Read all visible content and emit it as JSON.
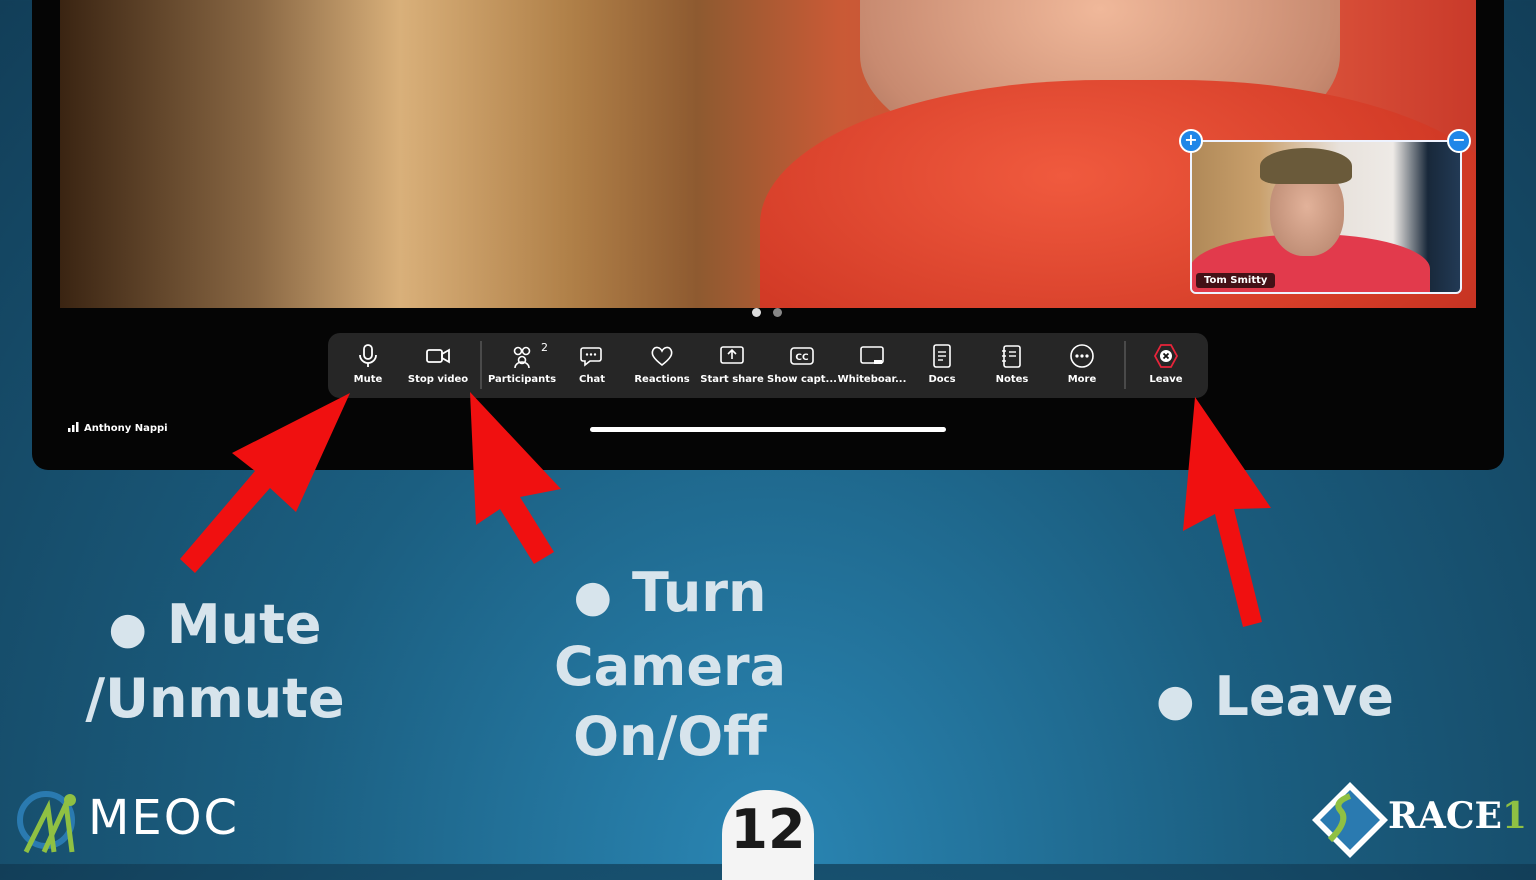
{
  "video": {
    "pip_name": "Tom Smitty",
    "pip_add_symbol": "+",
    "pip_remove_symbol": "−"
  },
  "page_dots": {
    "count": 2,
    "active_index": 0,
    "active_color": "#dddddd",
    "inactive_color": "#888888"
  },
  "toolbar": {
    "items": [
      {
        "label": "Mute",
        "icon": "microphone-icon"
      },
      {
        "label": "Stop video",
        "icon": "video-camera-icon"
      },
      {
        "label": "Participants",
        "icon": "participants-icon",
        "badge": "2"
      },
      {
        "label": "Chat",
        "icon": "chat-icon"
      },
      {
        "label": "Reactions",
        "icon": "heart-icon"
      },
      {
        "label": "Start share",
        "icon": "share-screen-icon"
      },
      {
        "label": "Show capt...",
        "icon": "closed-captions-icon"
      },
      {
        "label": "Whiteboar...",
        "icon": "whiteboard-icon"
      },
      {
        "label": "Docs",
        "icon": "docs-icon"
      },
      {
        "label": "Notes",
        "icon": "notes-icon"
      },
      {
        "label": "More",
        "icon": "more-icon"
      },
      {
        "label": "Leave",
        "icon": "leave-icon",
        "color": "#e8243a"
      }
    ],
    "cc_glyph": "CC"
  },
  "user": {
    "name": "Anthony Nappi"
  },
  "captions": {
    "mute": [
      "Mute",
      "/Unmute"
    ],
    "camera": [
      "Turn",
      "Camera",
      "On/Off"
    ],
    "leave": [
      "Leave"
    ],
    "bullet": "●"
  },
  "slide_number": "12",
  "logos": {
    "left_text": "MEOC",
    "right_text": "RACE",
    "right_suffix": "1",
    "right_suffix_color": "#8fc043"
  },
  "colors": {
    "arrow": "#f01010",
    "pip_button": "#1f86e8",
    "toolbar_bg": "#262626"
  }
}
